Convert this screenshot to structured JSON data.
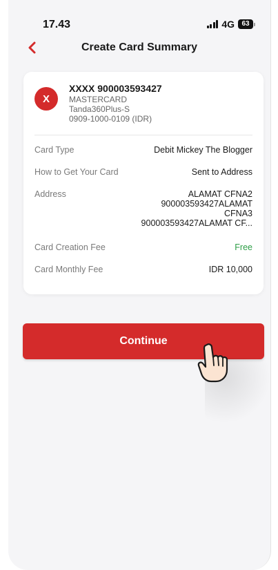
{
  "status_bar": {
    "time": "17.43",
    "network": "4G",
    "battery": "63",
    "icons": [
      "signal-icon",
      "battery-icon"
    ]
  },
  "nav": {
    "back_icon": "chevron-left-icon",
    "title": "Create Card Summary"
  },
  "card": {
    "avatar_letter": "X",
    "number": "XXXX 900003593427",
    "brand": "MASTERCARD",
    "product": "Tanda360Plus-S",
    "account": "0909-1000-0109 (IDR)"
  },
  "details": {
    "card_type": {
      "label": "Card Type",
      "value": "Debit Mickey The Blogger"
    },
    "delivery": {
      "label": "How to Get Your Card",
      "value": "Sent to Address"
    },
    "address": {
      "label": "Address",
      "lines": [
        "ALAMAT CFNA2",
        "900003593427ALAMAT",
        "CFNA3",
        "900003593427ALAMAT CF..."
      ]
    },
    "creation_fee": {
      "label": "Card Creation Fee",
      "value": "Free"
    },
    "monthly_fee": {
      "label": "Card Monthly Fee",
      "value": "IDR 10,000"
    }
  },
  "actions": {
    "continue_label": "Continue"
  },
  "colors": {
    "accent": "#d42b2b",
    "free": "#2e9e47",
    "background": "#f5f5f7"
  }
}
